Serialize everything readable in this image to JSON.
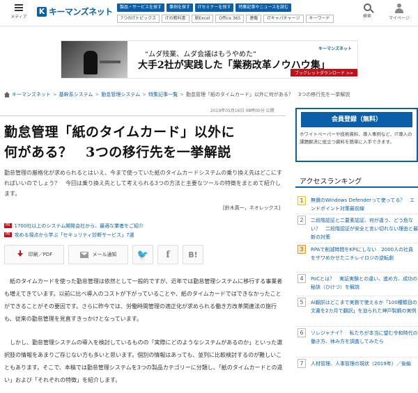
{
  "header": {
    "menu_label": "メディア",
    "logo_mark": "K",
    "logo_text": "キーマンズネット",
    "nav_top": [
      "製品・サービスを探す",
      "事例を探す",
      "ITセミナーを探す",
      "特集記事やニュースを読む"
    ],
    "nav_bottom": [
      "7つのITトピックス",
      "ITの教科書",
      "脱Excel",
      "Office 365",
      "連載",
      "ITキャパチャージ",
      "キーワード"
    ],
    "search_label": "検索",
    "mypage_label": "マイページ"
  },
  "banner": {
    "quote": "“ムダ残業、ムダ会議はもうやめた”",
    "headline": "大手2社が実践した「業務改革ノウハウ集」",
    "logo": "キーマンズネット",
    "download": "ブックレットダウンロード >>"
  },
  "breadcrumb": [
    "キーマンズネット",
    "基幹系システム",
    "勤怠管理システム",
    "特集記事一覧",
    "勤怠管理「紙のタイムカード」以外に何がある？　3つの移行先を一挙解説"
  ],
  "article": {
    "date": "2019年05月16日 08時00分 公開",
    "title_line1": "勤怠管理「紙のタイムカード」以外に",
    "title_line2": "何がある？　3つの移行先を一挙解説",
    "lead": "勤怠管理の厳格化が求められるとはいえ、今まで使っていた紙のタイムカードシステムの乗り換え先はどこにすればいいのでしょう？　今回は乗り換え先として考えられる3つの方法と主要なツールの特徴をまとめて紹介します。",
    "byline": "[鈴木真一，ネオレックス]",
    "pr_badge": "PR",
    "pr_links": [
      "1700社以上のシステム開発会社から、最適な業者をご紹介",
      "攻める視点から学ぶ「セキュリティ診断サービス」7選"
    ],
    "share": {
      "print": "印刷／PDF",
      "mail": "メール通知",
      "twitter": "𝕏",
      "facebook": "f",
      "hatena": "B!"
    },
    "para1": "紙のタイムカードを使った勤怠管理は依然として一般的ですが、近年では勤怠管理システムに移行する事業者も増えてきています。以前に比べ導入のコストが下がっていることや、紙のタイムカードではできなかったことができることがその要因です。さらに昨今では、労働時間管理の適正化が求められる働き方改革関連法の施行も、従来の勤怠管理を見直すきっかけとなっています。",
    "para2": "しかし、勤怠管理システムの導入を検討しているものの「実際にどのようなシステムがあるのか」といった選択肢の情報をあまりご存じない方も多いと思います。個別の情報はあっても、並列に比較検討するのが難しいこともあります。そこで、本稿では勤怠管理システムを3つの製品カテゴリーに分類し、「紙のタイムカードとの違い」および「それぞれの特徴」を紹介します。"
  },
  "sidebar": {
    "register_button": "会員登録（無料）",
    "register_desc": "ホワイトペーパーや技術資料、導入事例など、IT導入の課題解決に役立つ資料を簡単に入手できます。",
    "ranking_title": "アクセスランキング",
    "ranking": [
      {
        "num": "1",
        "text": "無償のWindows Defenderって使ってる？　エンドポイント対策最前線"
      },
      {
        "num": "2",
        "text": "二段階認証と二要素認証、何が違う、どう危ない？　二段階認証が安全と言い切れない理由と最新の対策"
      },
      {
        "num": "3",
        "text": "RPAで削減時間をKPIにしない　2000人の社員をザワめかせたニチレイロジの逆転劇"
      },
      {
        "num": "4",
        "text": "PoCとは？　実証実験との違い、進め方、成功の秘訣（ひけつ）を解説"
      },
      {
        "num": "5",
        "text": "AI翻訳はどこまで実務で使えるか「100種類目の文書を2カ月で翻訳」を迫られた神戸製鋼の実例"
      },
      {
        "num": "6",
        "text": "ソレジャナイ？　私たちが本当に望む令和時代の働き方、休み方を調査してみたら"
      },
      {
        "num": "7",
        "text": "人材管理、人事管理の現状（2019年）／後編"
      }
    ]
  }
}
